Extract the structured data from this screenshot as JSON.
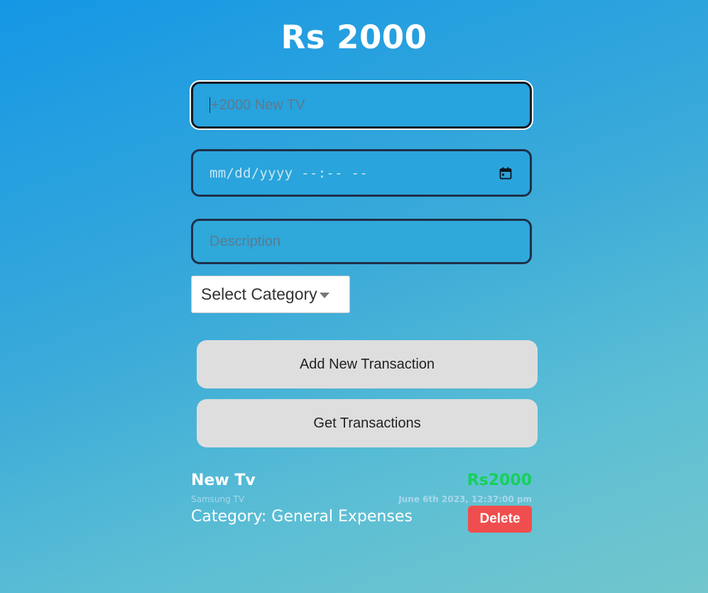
{
  "balance": "Rs 2000",
  "form": {
    "amount_placeholder": "+2000 New TV",
    "date_placeholder": "mm/dd/yyyy --:-- --",
    "description_placeholder": "Description",
    "category_selected": "Select Category"
  },
  "buttons": {
    "add": "Add New Transaction",
    "get": "Get Transactions"
  },
  "transactions": [
    {
      "title": "New Tv",
      "amount": "Rs2000",
      "description": "Samsung TV",
      "datetime": "June 6th 2023, 12:37:00 pm",
      "category": "Category: General Expenses",
      "delete_label": "Delete"
    }
  ],
  "colors": {
    "positive_amount": "#17d05a",
    "delete_button": "#f04e4e",
    "button_bg": "#dedede"
  },
  "icons": {
    "date_field": "calendar-icon",
    "select": "caret-down-icon"
  }
}
